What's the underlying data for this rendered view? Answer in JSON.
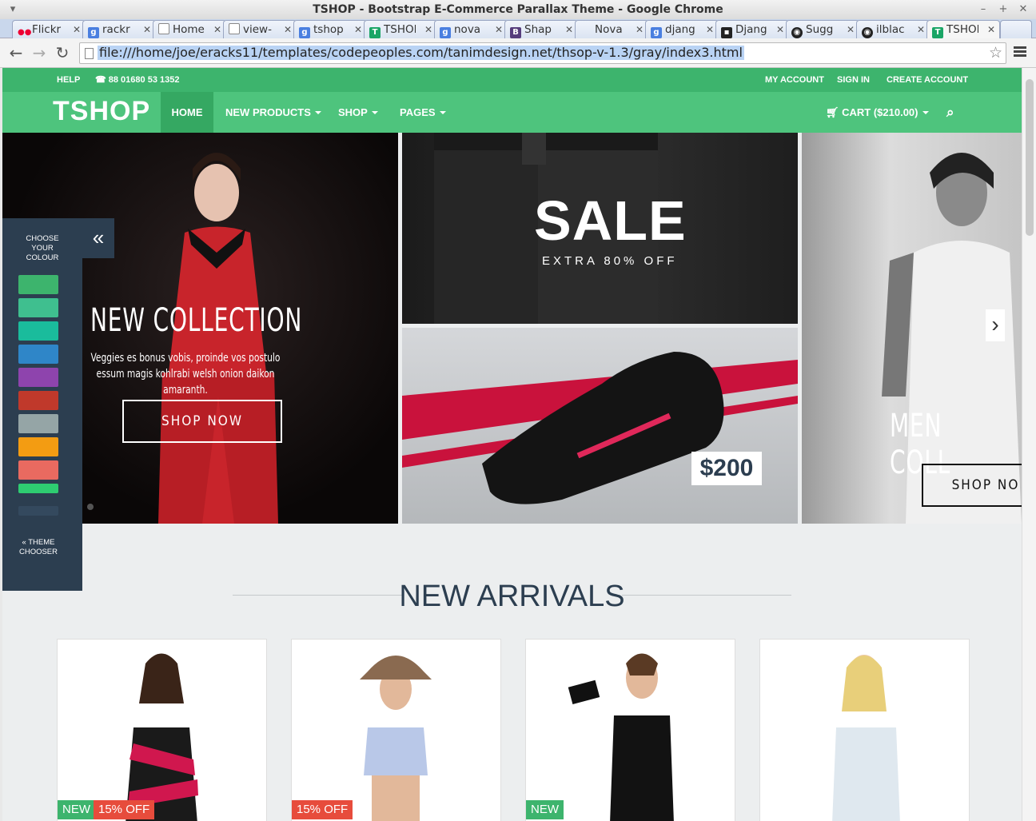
{
  "window": {
    "title": "TSHOP - Bootstrap E-Commerce Parallax Theme - Google Chrome"
  },
  "tabs": [
    {
      "label": "Flickr",
      "icon": "flickr-icon"
    },
    {
      "label": "rackr",
      "icon": "google-icon"
    },
    {
      "label": "Home",
      "icon": "page-icon"
    },
    {
      "label": "view-",
      "icon": "page-icon"
    },
    {
      "label": "tshop",
      "icon": "google-icon"
    },
    {
      "label": "TSHOP",
      "icon": "tshop-icon"
    },
    {
      "label": "nova",
      "icon": "google-icon"
    },
    {
      "label": "Shap",
      "icon": "bootstrap-icon"
    },
    {
      "label": "Nova",
      "icon": "none"
    },
    {
      "label": "djang",
      "icon": "google-icon"
    },
    {
      "label": "Djang",
      "icon": "bag-icon"
    },
    {
      "label": "Sugg",
      "icon": "github-icon"
    },
    {
      "label": "ilblac",
      "icon": "github-icon"
    },
    {
      "label": "TSHOP",
      "icon": "tshop-icon"
    }
  ],
  "address_bar": {
    "url": "file:///home/joe/eracks11/templates/codepeoples.com/tanimdesign.net/thsop-v-1.3/gray/index3.html"
  },
  "site": {
    "topbar": {
      "help": "HELP",
      "phone": "88 01680 53 1352",
      "my_account": "MY ACCOUNT",
      "sign_in": "SIGN IN",
      "create_account": "CREATE ACCOUNT"
    },
    "logo": "TSHOP",
    "nav": [
      "HOME",
      "NEW PRODUCTS",
      "SHOP",
      "PAGES"
    ],
    "cart": "CART ($210.00)",
    "hero1": {
      "title": "NEW COLLECTION",
      "desc": "Veggies es bonus vobis, proinde vos postulo essum magis kohlrabi welsh onion daikon amaranth.",
      "button": "SHOP NOW"
    },
    "hero2": {
      "title": "SALE",
      "subtitle": "EXTRA 80% OFF"
    },
    "hero3": {
      "price": "$200"
    },
    "hero4": {
      "title": "MEN COLL",
      "button": "SHOP NO"
    },
    "chooser": {
      "heading": "CHOOSE YOUR COLOUR",
      "footer": "« THEME CHOOSER",
      "swatches": [
        "#3db46d",
        "#3fbf8f",
        "#1abc9c",
        "#2f86c8",
        "#8e44ad",
        "#c0392b",
        "#95a5a6",
        "#f39c12",
        "#e96a60",
        "#2ecc71",
        "#2c3e50",
        "#34495e"
      ]
    },
    "section_title": "NEW ARRIVALS",
    "products": [
      {
        "badges": [
          {
            "text": "NEW",
            "color": "#3db46d"
          },
          {
            "text": "15% OFF",
            "color": "#e74c3c"
          }
        ]
      },
      {
        "badges": [
          {
            "text": "15% OFF",
            "color": "#e74c3c"
          }
        ]
      },
      {
        "badges": [
          {
            "text": "NEW",
            "color": "#3db46d"
          }
        ]
      },
      {
        "badges": []
      }
    ]
  }
}
